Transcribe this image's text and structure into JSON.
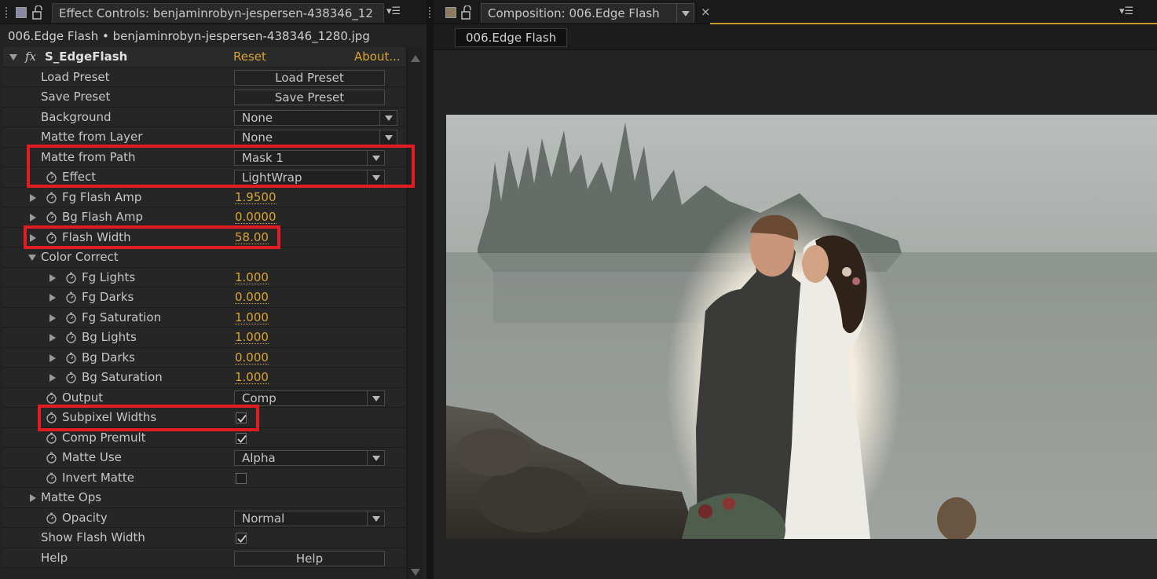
{
  "effect_panel": {
    "tab_title": "Effect Controls: benjaminrobyn-jespersen-438346_12",
    "layer_line": "006.Edge Flash • benjaminrobyn-jespersen-438346_1280.jpg",
    "effect_name": "S_EdgeFlash",
    "fx_label": "fx",
    "reset_label": "Reset",
    "about_label": "About...",
    "rows": {
      "load_preset": {
        "label": "Load Preset",
        "button": "Load Preset"
      },
      "save_preset": {
        "label": "Save Preset",
        "button": "Save Preset"
      },
      "background": {
        "label": "Background",
        "value": "None"
      },
      "matte_from_layer": {
        "label": "Matte from Layer",
        "value": "None"
      },
      "matte_from_path": {
        "label": "Matte from Path",
        "value": "Mask 1"
      },
      "effect": {
        "label": "Effect",
        "value": "LightWrap"
      },
      "fg_flash_amp": {
        "label": "Fg Flash Amp",
        "value": "1.9500"
      },
      "bg_flash_amp": {
        "label": "Bg Flash Amp",
        "value": "0.0000"
      },
      "flash_width": {
        "label": "Flash Width",
        "value": "58.00"
      },
      "color_correct": {
        "label": "Color Correct"
      },
      "fg_lights": {
        "label": "Fg Lights",
        "value": "1.000"
      },
      "fg_darks": {
        "label": "Fg Darks",
        "value": "0.000"
      },
      "fg_saturation": {
        "label": "Fg Saturation",
        "value": "1.000"
      },
      "bg_lights": {
        "label": "Bg Lights",
        "value": "1.000"
      },
      "bg_darks": {
        "label": "Bg Darks",
        "value": "0.000"
      },
      "bg_saturation": {
        "label": "Bg Saturation",
        "value": "1.000"
      },
      "output": {
        "label": "Output",
        "value": "Comp"
      },
      "subpixel_widths": {
        "label": "Subpixel Widths",
        "checked": true
      },
      "comp_premult": {
        "label": "Comp Premult",
        "checked": true
      },
      "matte_use": {
        "label": "Matte Use",
        "value": "Alpha"
      },
      "invert_matte": {
        "label": "Invert Matte",
        "checked": false
      },
      "matte_ops": {
        "label": "Matte Ops"
      },
      "opacity": {
        "label": "Opacity",
        "value": "Normal"
      },
      "show_flash_width": {
        "label": "Show Flash Width",
        "checked": true
      },
      "help": {
        "label": "Help",
        "button": "Help"
      }
    }
  },
  "composition_panel": {
    "tab_title": "Composition: 006.Edge Flash",
    "comp_tab": "006.Edge Flash"
  },
  "colors": {
    "accent_value": "#d8a531",
    "highlight": "#e31c24",
    "panel_bg": "#232323"
  }
}
